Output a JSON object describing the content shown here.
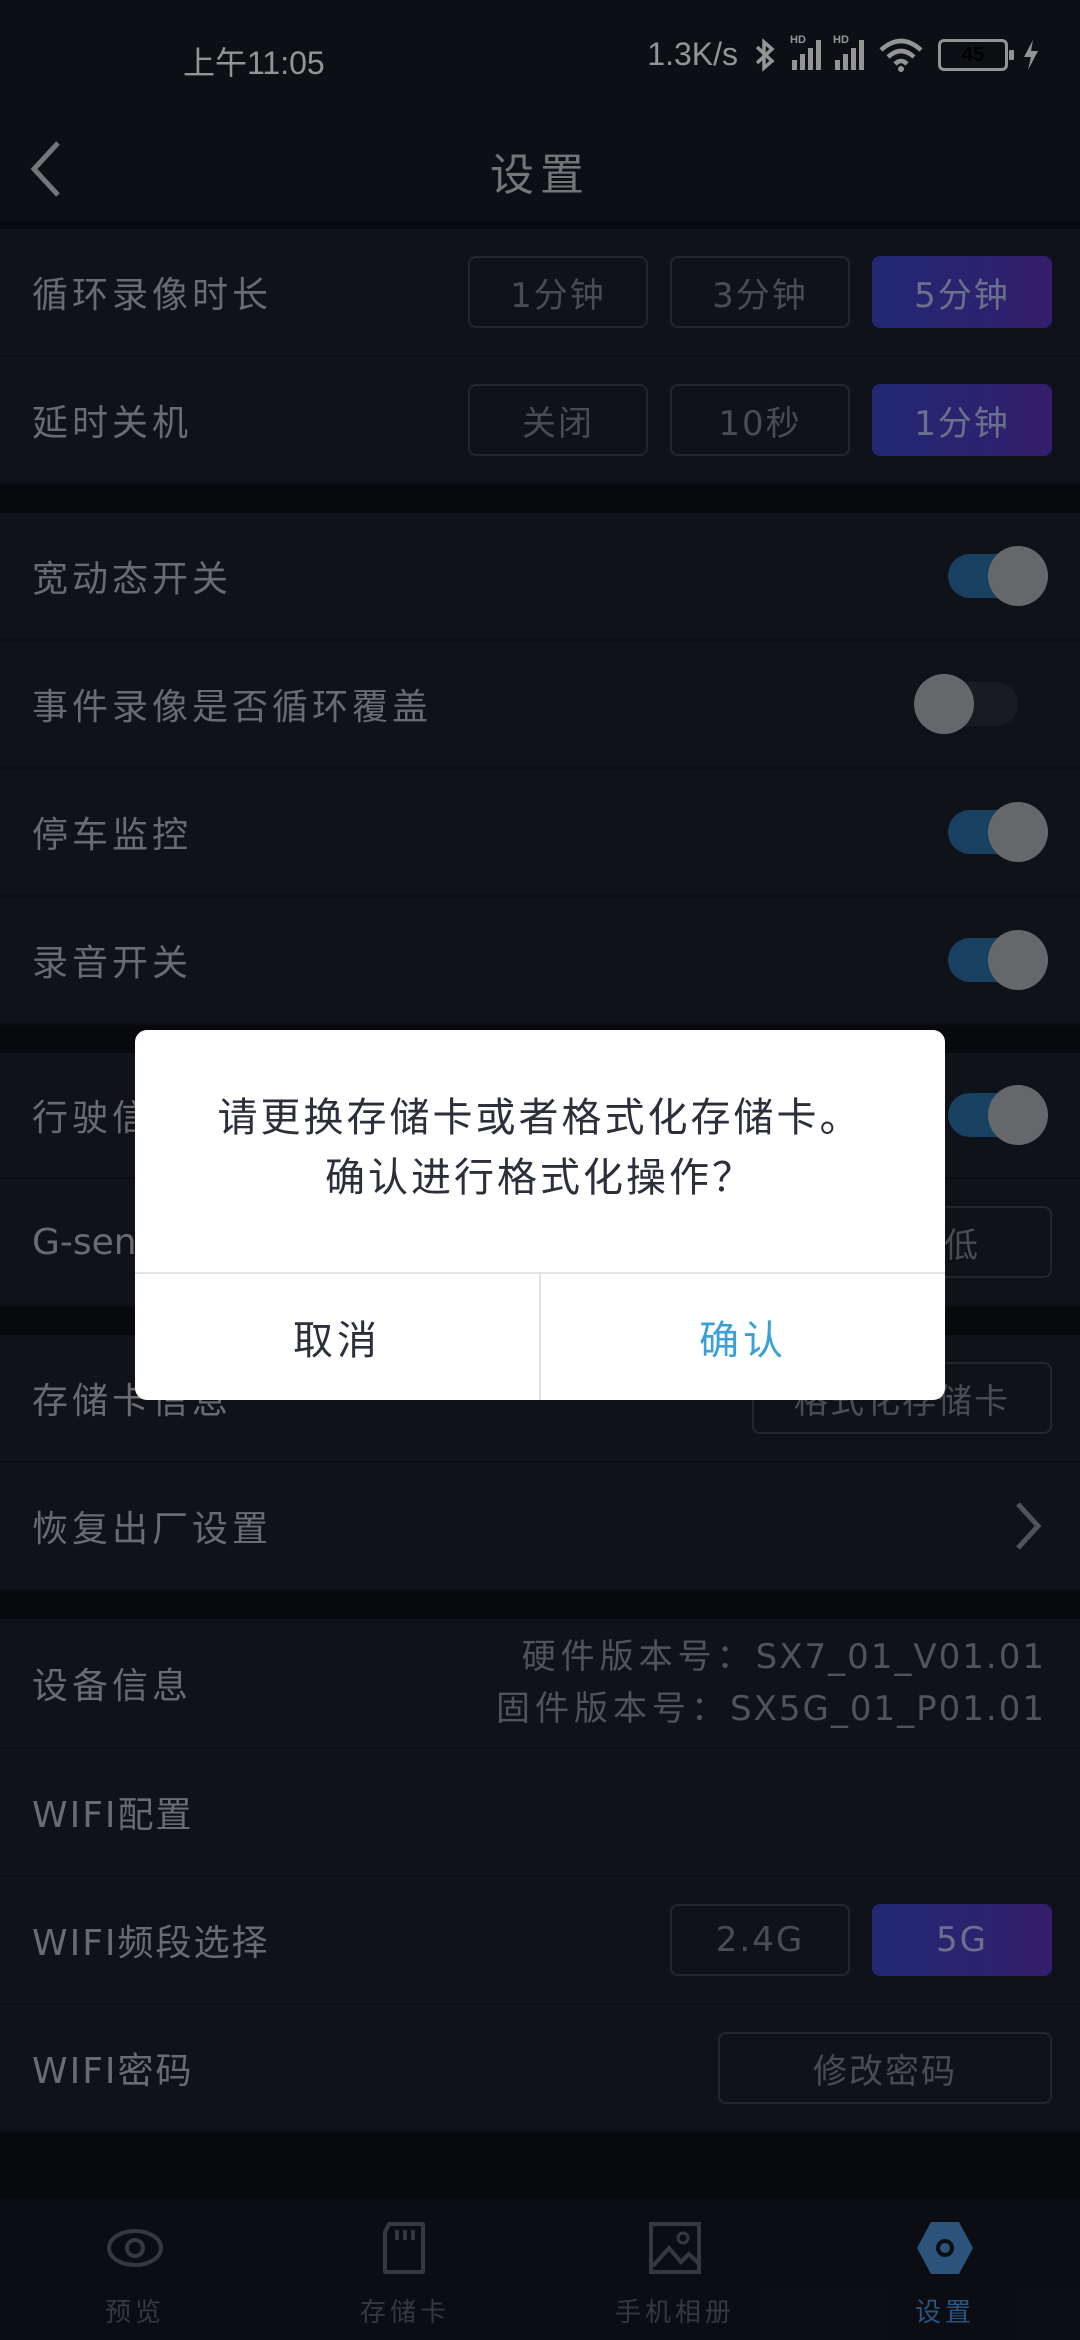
{
  "status_bar": {
    "time": "上午11:05",
    "net_speed": "1.3K/s",
    "battery": "45"
  },
  "header": {
    "title": "设置"
  },
  "settings": {
    "loop_record": {
      "label": "循环录像时长",
      "options": [
        "1分钟",
        "3分钟",
        "5分钟"
      ],
      "selected": "5分钟"
    },
    "delay_off": {
      "label": "延时关机",
      "options": [
        "关闭",
        "10秒",
        "1分钟"
      ],
      "selected": "1分钟"
    },
    "wdr": {
      "label": "宽动态开关",
      "on": true
    },
    "event_loop": {
      "label": "事件录像是否循环覆盖",
      "on": false
    },
    "parking": {
      "label": "停车监控",
      "on": true
    },
    "audio": {
      "label": "录音开关",
      "on": true
    },
    "driving": {
      "label": "行驶信",
      "on": true
    },
    "gsensor": {
      "label": "G-sens",
      "option": "低"
    },
    "storage": {
      "label": "存储卡信息",
      "button": "格式化存储卡"
    },
    "factory": {
      "label": "恢复出厂设置"
    },
    "device": {
      "label": "设备信息",
      "hw_key": "硬件版本号：",
      "hw_val": "SX7_01_V01.01",
      "fw_key": "固件版本号：",
      "fw_val": "SX5G_01_P01.01"
    },
    "wifi_config": {
      "label": "WIFI配置"
    },
    "wifi_band": {
      "label": "WIFI频段选择",
      "options": [
        "2.4G",
        "5G"
      ],
      "selected": "5G"
    },
    "wifi_pwd": {
      "label": "WIFI密码",
      "button": "修改密码"
    }
  },
  "bottom_nav": [
    {
      "label": "预览",
      "icon": "eye-icon"
    },
    {
      "label": "存储卡",
      "icon": "sd-card-icon"
    },
    {
      "label": "手机相册",
      "icon": "gallery-icon"
    },
    {
      "label": "设置",
      "icon": "settings-icon",
      "active": true
    }
  ],
  "dialog": {
    "line1": "请更换存储卡或者格式化存储卡。",
    "line2": "确认进行格式化操作？",
    "cancel": "取消",
    "confirm": "确认"
  },
  "colors": {
    "accent": "#3aa0d8",
    "active_nav": "#4a8fd6",
    "toggle_on": "#2a6ea6"
  }
}
